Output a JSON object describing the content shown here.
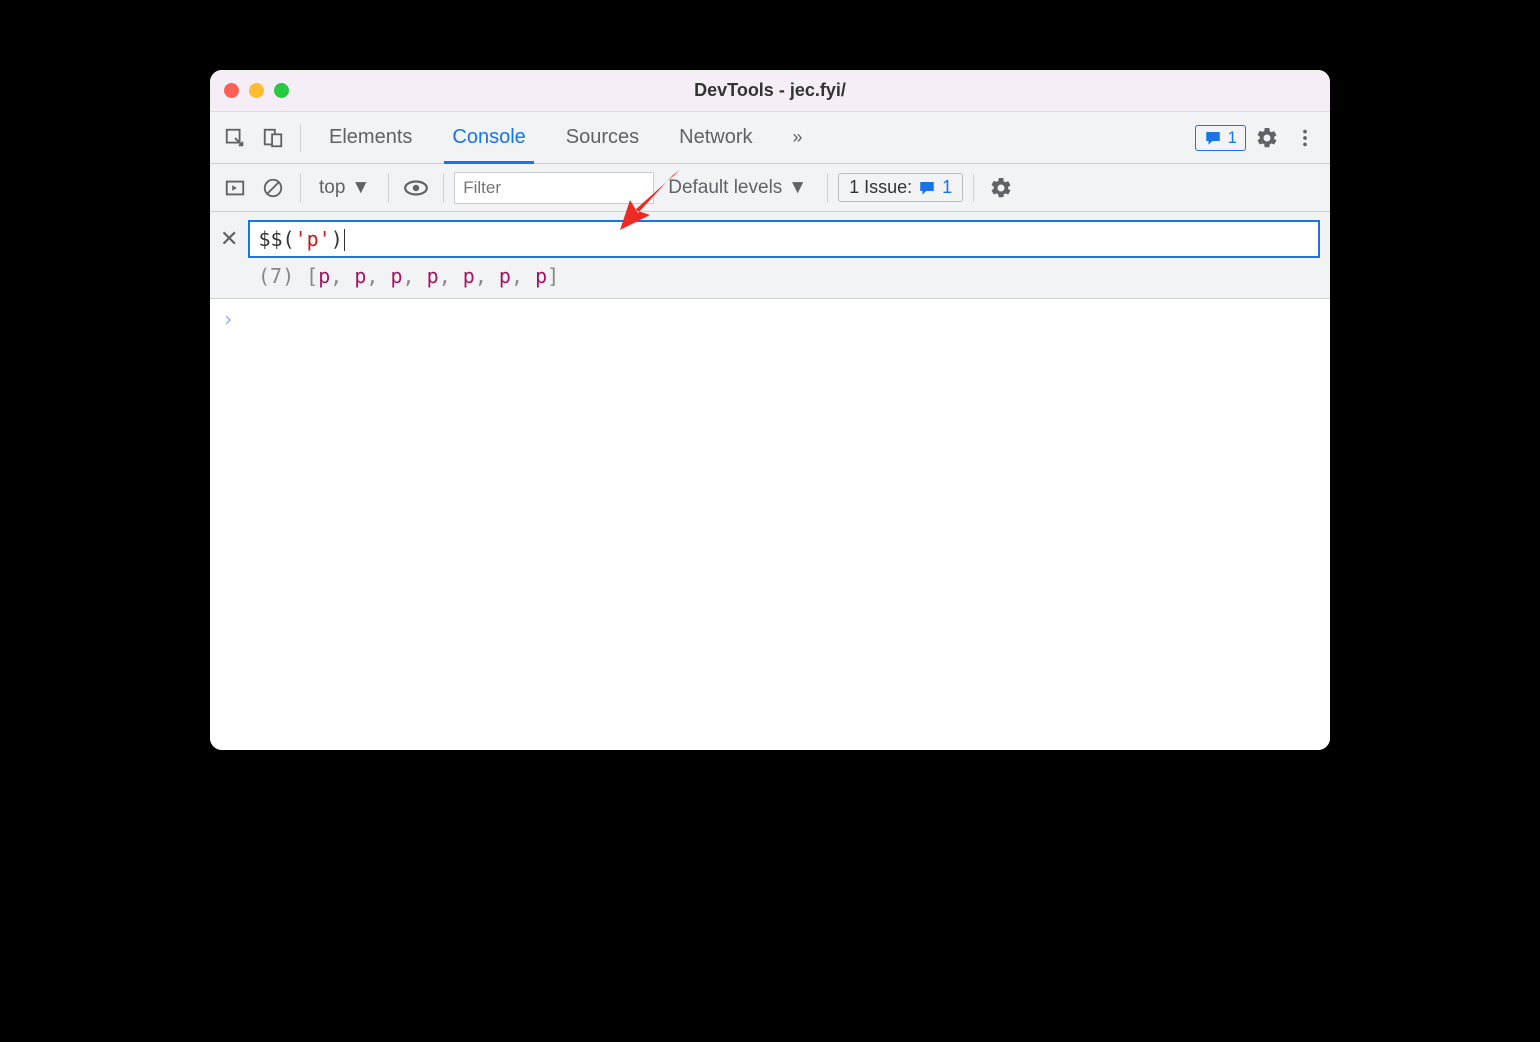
{
  "window": {
    "title": "DevTools - jec.fyi/"
  },
  "tabs": {
    "items": [
      "Elements",
      "Console",
      "Sources",
      "Network"
    ],
    "active_index": 1,
    "more_label": "»",
    "feedback_count": "1"
  },
  "console_toolbar": {
    "context": "top",
    "filter_placeholder": "Filter",
    "levels_label": "Default levels",
    "issues_label": "1 Issue:",
    "issues_count": "1"
  },
  "eval": {
    "expression_pre": "$$(",
    "expression_str": "'p'",
    "expression_post": ")",
    "result_count": "(7)",
    "result_elements": [
      "p",
      "p",
      "p",
      "p",
      "p",
      "p",
      "p"
    ]
  },
  "prompt": {
    "caret": "›"
  }
}
